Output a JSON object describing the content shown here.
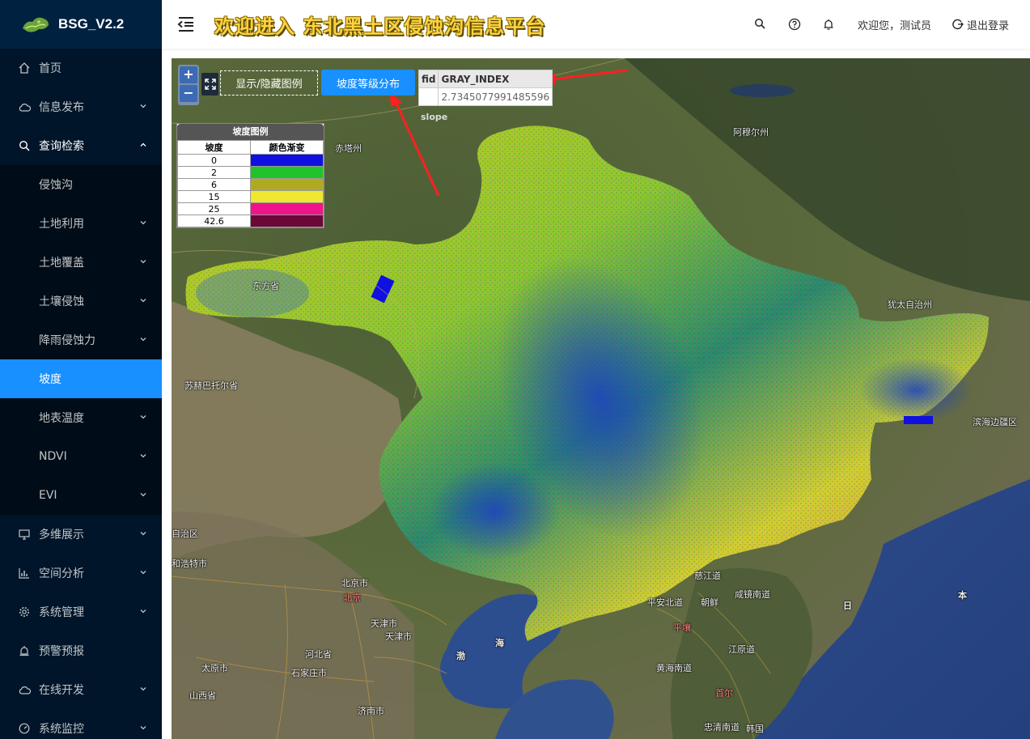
{
  "app": {
    "logo_text": "BSG_V2.2"
  },
  "header": {
    "title": "欢迎进入 东北黑土区侵蚀沟信息平台",
    "welcome": "欢迎您，测试员",
    "logout": "退出登录"
  },
  "sidebar": {
    "items": [
      {
        "label": "首页",
        "icon": "home-icon"
      },
      {
        "label": "信息发布",
        "icon": "cloud-icon"
      },
      {
        "label": "查询检索",
        "icon": "search-icon"
      }
    ],
    "sub": [
      {
        "label": "侵蚀沟"
      },
      {
        "label": "土地利用"
      },
      {
        "label": "土地覆盖"
      },
      {
        "label": "土壤侵蚀"
      },
      {
        "label": "降雨侵蚀力"
      },
      {
        "label": "坡度"
      },
      {
        "label": "地表温度"
      },
      {
        "label": "NDVI"
      },
      {
        "label": "EVI"
      }
    ],
    "items2": [
      {
        "label": "多维展示",
        "icon": "monitor-icon"
      },
      {
        "label": "空间分析",
        "icon": "bar-chart-icon"
      },
      {
        "label": "系统管理",
        "icon": "gear-icon"
      },
      {
        "label": "预警预报",
        "icon": "alarm-icon"
      },
      {
        "label": "在线开发",
        "icon": "cloud-icon"
      },
      {
        "label": "系统监控",
        "icon": "dashboard-icon"
      }
    ]
  },
  "map": {
    "zoom_in": "+",
    "zoom_out": "−",
    "legend_toggle": "显示/隐藏图例",
    "slope_button": "坡度等级分布",
    "info": {
      "col1": "fid",
      "col2": "GRAY_INDEX",
      "value": "2.7345077991485596"
    },
    "layer_label": "slope",
    "legend": {
      "title": "坡度图例",
      "col1": "坡度",
      "col2": "颜色渐变",
      "rows": [
        {
          "value": "0",
          "color": "#1010e0"
        },
        {
          "value": "2",
          "color": "#22c32a"
        },
        {
          "value": "6",
          "color": "#b0aa20"
        },
        {
          "value": "15",
          "color": "#f0e830"
        },
        {
          "value": "25",
          "color": "#f0148a"
        },
        {
          "value": "42.6",
          "color": "#6a0838"
        }
      ]
    },
    "places": [
      {
        "text": "阿穆尔州"
      },
      {
        "text": "赤塔州"
      },
      {
        "text": "东方省"
      },
      {
        "text": "犹太自治州"
      },
      {
        "text": "苏赫巴托尔省"
      },
      {
        "text": "滨海边疆区"
      },
      {
        "text": "自治区"
      },
      {
        "text": "和浩特市"
      },
      {
        "text": "北京市"
      },
      {
        "text": "北京"
      },
      {
        "text": "天津市"
      },
      {
        "text": "天津市"
      },
      {
        "text": "河北省"
      },
      {
        "text": "太原市"
      },
      {
        "text": "石家庄市"
      },
      {
        "text": "山西省"
      },
      {
        "text": "济南市"
      },
      {
        "text": "慈江道"
      },
      {
        "text": "平安北道"
      },
      {
        "text": "朝鲜"
      },
      {
        "text": "咸镜南道"
      },
      {
        "text": "平壤"
      },
      {
        "text": "江原道"
      },
      {
        "text": "黄海南道"
      },
      {
        "text": "首尔"
      },
      {
        "text": "忠清南道"
      },
      {
        "text": "韩国"
      },
      {
        "text": "渤"
      },
      {
        "text": "海"
      },
      {
        "text": "日"
      },
      {
        "text": "本"
      }
    ]
  }
}
